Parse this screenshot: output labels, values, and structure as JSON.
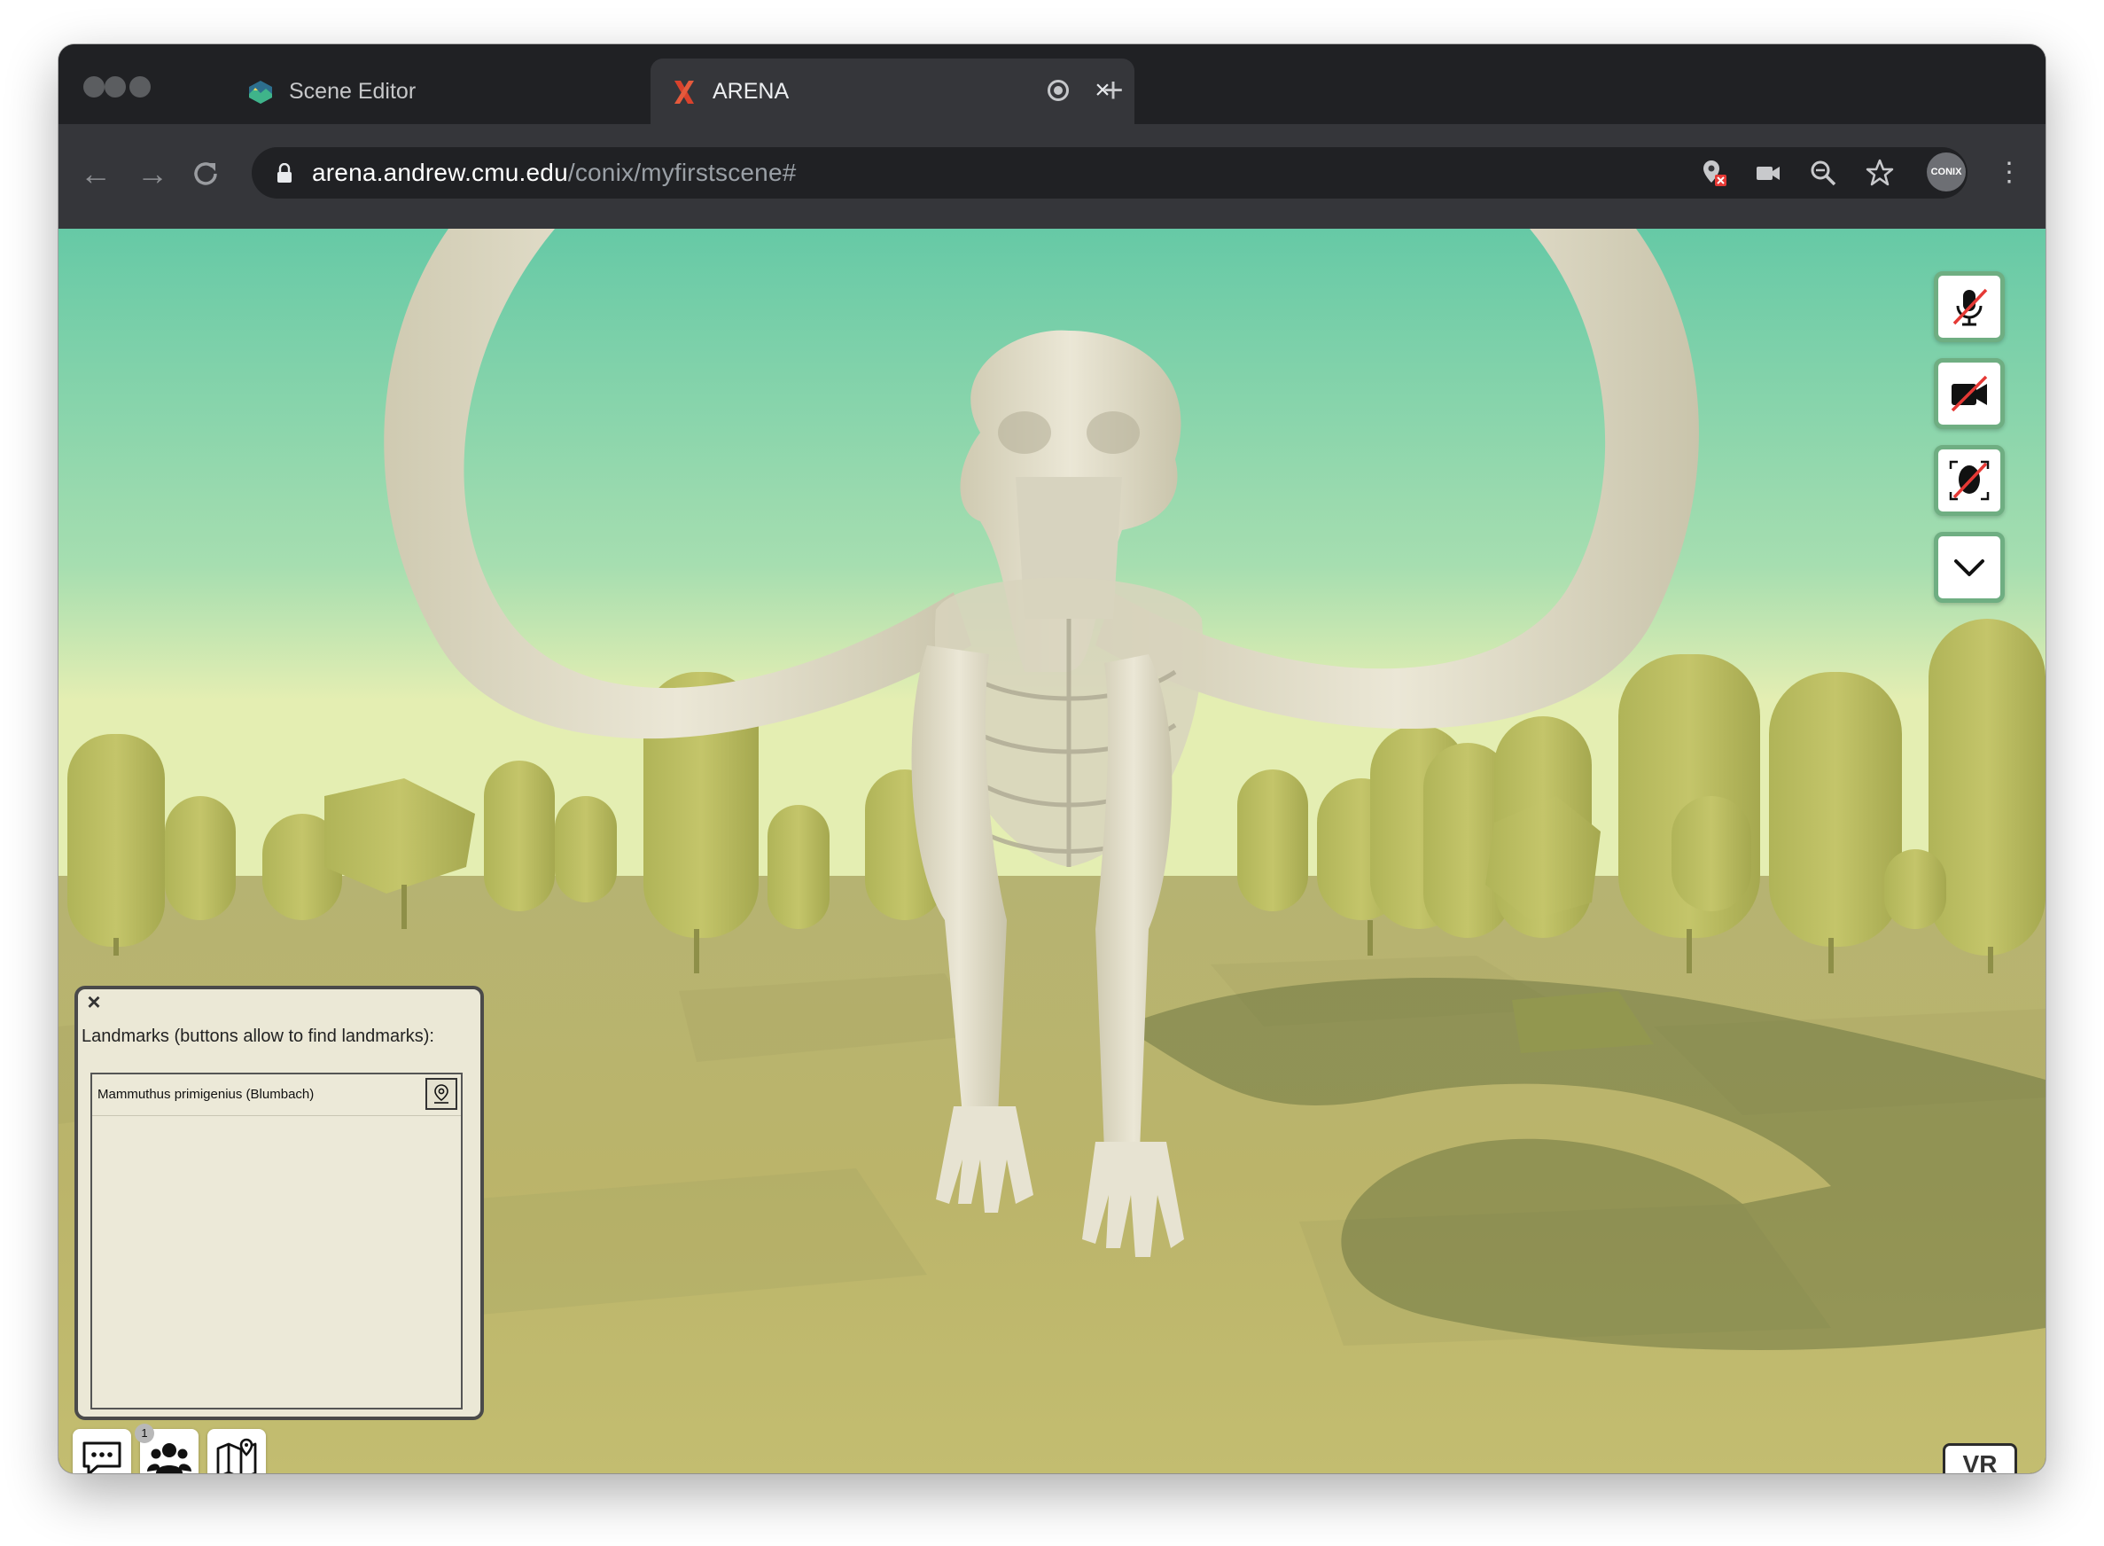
{
  "browser": {
    "tabs": [
      {
        "title": "Scene Editor",
        "favicon": "scene-editor-icon",
        "active": false
      },
      {
        "title": "ARENA",
        "favicon": "arena-x-logo",
        "active": true,
        "recording": true
      }
    ],
    "new_tab_label": "+",
    "address": {
      "host": "arena.andrew.cmu.edu",
      "path": "/conix/myfirstscene#"
    },
    "profile_label": "CONIX",
    "toolbar_icons": [
      "location-blocked-icon",
      "video-camera-icon",
      "zoom-icon",
      "star-icon"
    ]
  },
  "arena": {
    "controls": [
      "mic-off-icon",
      "camera-off-icon",
      "avatar-off-icon",
      "chevron-down-icon"
    ],
    "landmarks": {
      "title": "Landmarks (buttons allow to find landmarks):",
      "items": [
        {
          "label": "Mammuthus primigenius (Blumbach)",
          "icon": "map-pin-icon"
        }
      ]
    },
    "bottom_buttons": [
      "chat-icon",
      "users-icon",
      "map-icon"
    ],
    "users_count": "1",
    "vr_label": "VR"
  },
  "colors": {
    "sky_top": "#6ccda8",
    "sky_horizon": "#e2ecb0",
    "ground": "#b9b46c",
    "trees": "#b7b85a",
    "bone": "#e4e0cf",
    "control_border": "#6fae82"
  }
}
